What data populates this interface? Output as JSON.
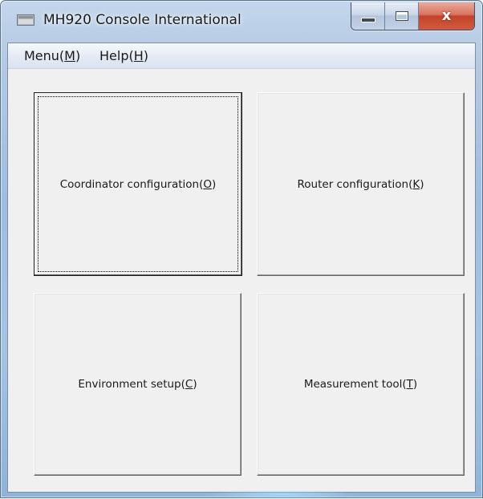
{
  "window": {
    "title": "MH920 Console International",
    "icon": "console-app-icon",
    "caption_buttons": [
      {
        "name": "minimize-button",
        "glyph": "minimize-icon"
      },
      {
        "name": "maximize-button",
        "glyph": "maximize-icon"
      },
      {
        "name": "close-button",
        "glyph": "close-icon",
        "label": "x"
      }
    ]
  },
  "menubar": {
    "menu": {
      "pre": "Menu(",
      "key": "M",
      "post": ")"
    },
    "help": {
      "pre": "Help(",
      "key": "H",
      "post": ")"
    }
  },
  "buttons": {
    "coordinator": {
      "pre": "Coordinator configuration(",
      "key": "O",
      "post": ")",
      "focused": true
    },
    "router": {
      "pre": "Router configuration(",
      "key": "K",
      "post": ")"
    },
    "environment": {
      "pre": "Environment setup(",
      "key": "C",
      "post": ")"
    },
    "measurement": {
      "pre": "Measurement tool(",
      "key": "T",
      "post": ")"
    }
  },
  "colors": {
    "client_bg": "#f0f0f0",
    "close_red": "#c2432b",
    "frame_blue": "#9fbedf"
  }
}
